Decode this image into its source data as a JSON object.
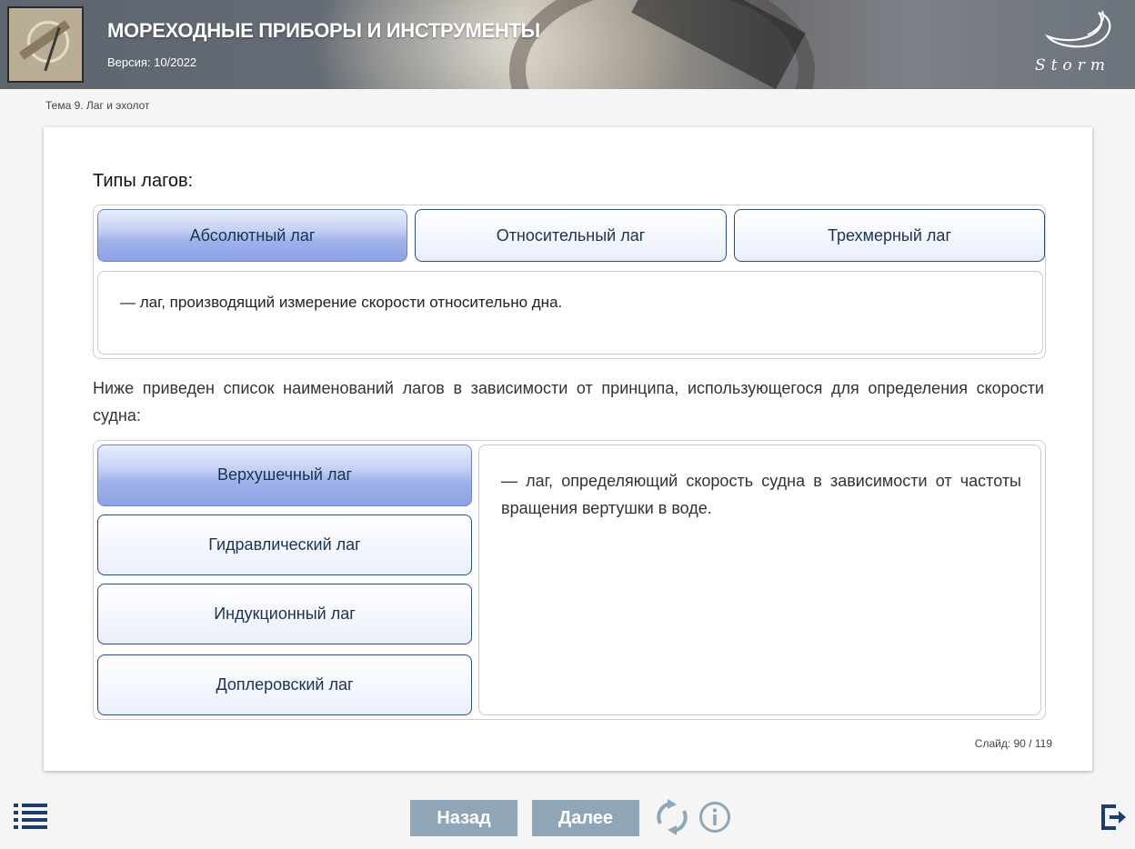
{
  "header": {
    "title": "МОРЕХОДНЫЕ ПРИБОРЫ И ИНСТРУМЕНТЫ",
    "version": "Версия: 10/2022",
    "logo_text": "Storm"
  },
  "breadcrumb": "Тема 9. Лаг и эхолот",
  "slide": {
    "types_heading": "Типы лагов:",
    "tabs": [
      {
        "label": "Абсолютный лаг",
        "active": true
      },
      {
        "label": "Относительный лаг",
        "active": false
      },
      {
        "label": "Трехмерный лаг",
        "active": false
      }
    ],
    "tab_description": "— лаг, производящий измерение скорости относительно дна.",
    "paragraph": "Ниже приведен список наименований лагов в зависимости от принципа, использующегося для определения скорости судна:",
    "list": [
      {
        "label": "Верхушечный лаг",
        "active": true
      },
      {
        "label": "Гидравлический лаг",
        "active": false
      },
      {
        "label": "Индукционный лаг",
        "active": false
      },
      {
        "label": "Доплеровский лаг",
        "active": false
      }
    ],
    "list_description": "— лаг, определяющий скорость судна в зависимости от частоты вращения вертушки в воде.",
    "slide_counter": "Слайд:  90 / 119"
  },
  "footer": {
    "back_label": "Назад",
    "next_label": "Далее",
    "icons": [
      "menu-icon",
      "reload-icon",
      "info-icon",
      "exit-icon"
    ],
    "button_color": "#8fa6b8",
    "icon_color": "#1d3e6b"
  }
}
